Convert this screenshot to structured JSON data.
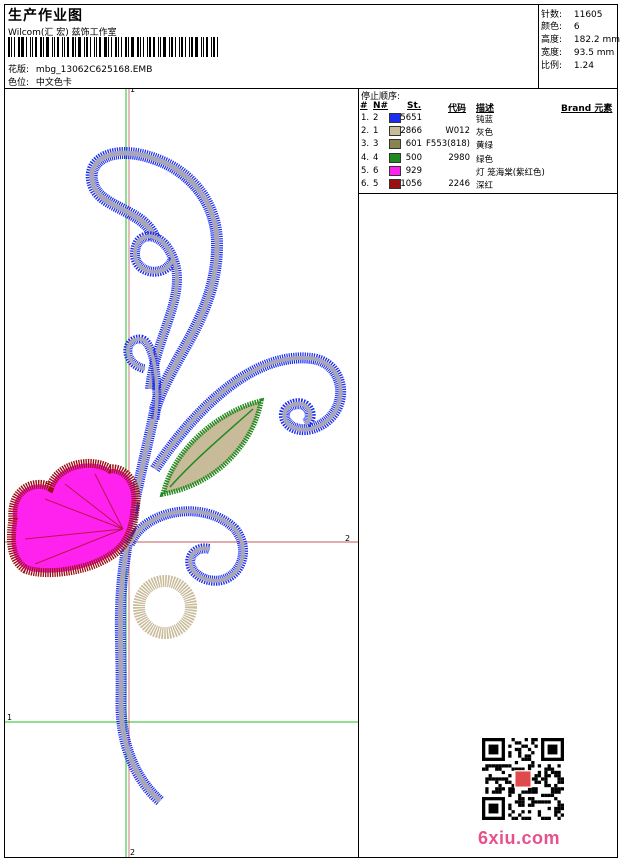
{
  "header": {
    "title": "生产作业图",
    "company": "Wilcom(汇 宏) 兹饰工作室",
    "design_label": "花版:",
    "design_value": "mbg_13062C625168.EMB",
    "colorway_label": "色位:",
    "colorway_value": "中文色卡"
  },
  "stats": [
    {
      "label": "针数:",
      "value": "11605"
    },
    {
      "label": "颜色:",
      "value": "6"
    },
    {
      "label": "高度:",
      "value": "182.2 mm"
    },
    {
      "label": "宽度:",
      "value": "93.5 mm"
    },
    {
      "label": "比例:",
      "value": "1.24"
    }
  ],
  "color_table": {
    "title": "停止顺序:",
    "headers": {
      "num": "#",
      "n": "N#",
      "st": "St.",
      "code": "代码",
      "desc": "描述",
      "brand": "Brand 元素"
    },
    "rows": [
      {
        "num": "1.",
        "n": "2",
        "color": "#1a2cf0",
        "st": "5651",
        "code": "",
        "desc": "钝蓝"
      },
      {
        "num": "2.",
        "n": "1",
        "color": "#c8bb9a",
        "st": "2866",
        "code": "W012",
        "desc": "灰色"
      },
      {
        "num": "3.",
        "n": "3",
        "color": "#8b8452",
        "st": "601",
        "code": "F553(818)",
        "desc": "黄绿"
      },
      {
        "num": "4.",
        "n": "4",
        "color": "#1f8a1f",
        "st": "500",
        "code": "2980",
        "desc": "绿色"
      },
      {
        "num": "5.",
        "n": "6",
        "color": "#ff22ee",
        "st": "929",
        "code": "",
        "desc": "灯 笼海棠(紫红色)"
      },
      {
        "num": "6.",
        "n": "5",
        "color": "#9a1010",
        "st": "1056",
        "code": "2246",
        "desc": "深红"
      }
    ]
  },
  "axis_labels": {
    "top_v": "1",
    "bottom_v": "2",
    "right_h": "2",
    "left_h": "1"
  },
  "watermark": "6xiu.com",
  "colors": {
    "blue": "#1a2cf0",
    "gray": "#a9a6b8",
    "khaki": "#c8bb9a",
    "green": "#1f8a1f",
    "magenta": "#ff22ee",
    "darkred": "#9a1010",
    "guide_green": "#22c022",
    "guide_red": "#b02020"
  }
}
